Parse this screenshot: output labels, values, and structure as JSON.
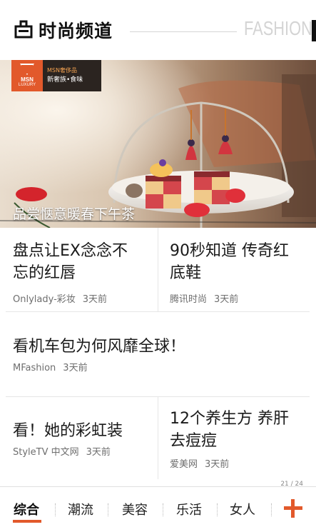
{
  "header": {
    "title": "时尚频道",
    "subtitle_en": "FASHION",
    "logo_icon": "bag-icon"
  },
  "hero": {
    "badge_brand": "MSN",
    "badge_brand_sub": "LUXURY",
    "badge_line1": "MSN奢侈品",
    "badge_line2": "新奢族•食味",
    "caption": "品尝惬意暖春下午茶"
  },
  "tiles": [
    {
      "title": "盘点让EX念念不忘的红唇",
      "source": "Onlylady-彩妆",
      "time": "3天前"
    },
    {
      "title": "90秒知道 传奇红底鞋",
      "source": "腾讯时尚",
      "time": "3天前"
    },
    {
      "title": "看机车包为何风靡全球！",
      "source": "MFashion",
      "time": "3天前"
    },
    {
      "title": "看！她的彩虹装",
      "source": "StyleTV 中文网",
      "time": "3天前"
    },
    {
      "title": "12个养生方 养肝去痘痘",
      "source": "爱美网",
      "time": "3天前"
    }
  ],
  "pager": {
    "text": "21 / 24"
  },
  "tabs": [
    {
      "label": "综合",
      "active": true
    },
    {
      "label": "潮流"
    },
    {
      "label": "美容"
    },
    {
      "label": "乐活"
    },
    {
      "label": "女人"
    }
  ],
  "colors": {
    "accent": "#e2592b",
    "text": "#1a1a1a",
    "meta": "#6e6e6e"
  },
  "add_button_icon": "plus-icon"
}
